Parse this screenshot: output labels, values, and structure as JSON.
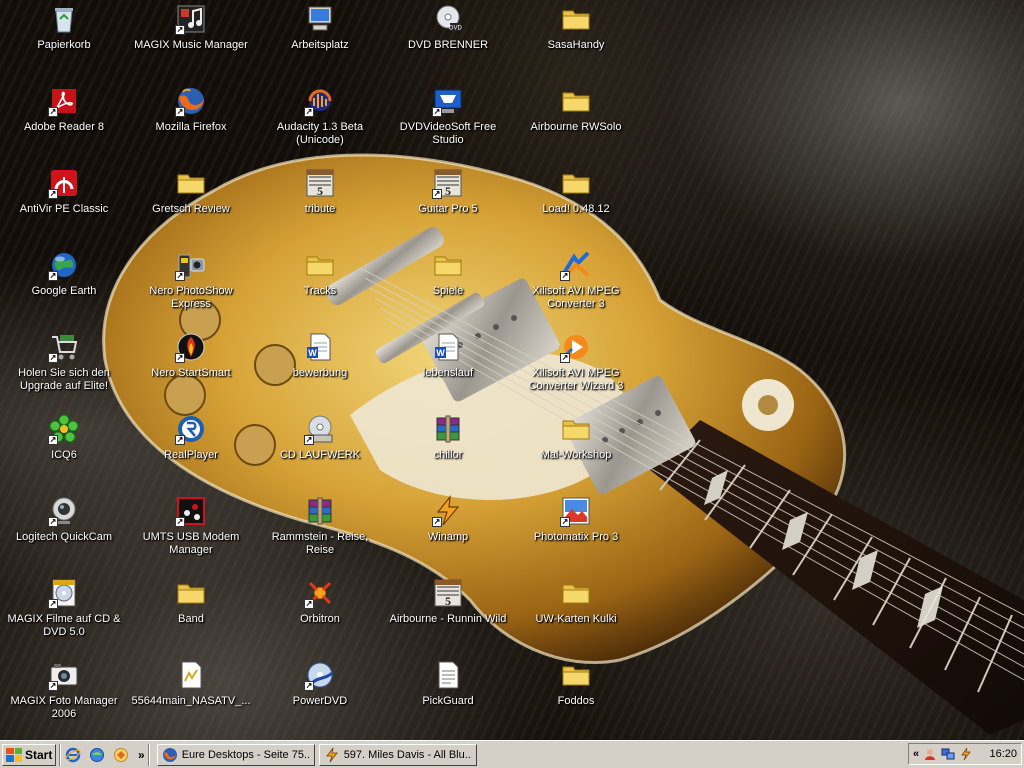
{
  "desktop": {
    "columns": [
      [
        {
          "label": "Papierkorb",
          "icon": "recycle-bin-icon",
          "shortcut": false
        },
        {
          "label": "Adobe Reader 8",
          "icon": "adobe-reader-icon",
          "shortcut": true
        },
        {
          "label": "AntiVir PE Classic",
          "icon": "antivir-umbrella-icon",
          "shortcut": true
        },
        {
          "label": "Google Earth",
          "icon": "google-earth-icon",
          "shortcut": true
        },
        {
          "label": "Holen Sie sich den Upgrade auf Elite!",
          "icon": "shopping-cart-icon",
          "shortcut": true
        },
        {
          "label": "ICQ6",
          "icon": "icq-flower-icon",
          "shortcut": true
        },
        {
          "label": "Logitech QuickCam",
          "icon": "webcam-icon",
          "shortcut": true
        },
        {
          "label": "MAGIX Filme auf CD & DVD 5.0",
          "icon": "magix-dvd-icon",
          "shortcut": true
        },
        {
          "label": "MAGIX Foto Manager 2006",
          "icon": "magix-camera-icon",
          "shortcut": true
        }
      ],
      [
        {
          "label": "MAGIX Music Manager",
          "icon": "magix-music-icon",
          "shortcut": true
        },
        {
          "label": "Mozilla Firefox",
          "icon": "firefox-icon",
          "shortcut": true
        },
        {
          "label": "Gretsch Review",
          "icon": "folder-icon",
          "shortcut": false
        },
        {
          "label": "Nero PhotoShow Express",
          "icon": "nero-photoshow-icon",
          "shortcut": true
        },
        {
          "label": "Nero StartSmart",
          "icon": "nero-startsmart-icon",
          "shortcut": true
        },
        {
          "label": "RealPlayer",
          "icon": "realplayer-icon",
          "shortcut": true
        },
        {
          "label": "UMTS USB Modem Manager",
          "icon": "umts-modem-icon",
          "shortcut": true
        },
        {
          "label": "Band",
          "icon": "folder-icon",
          "shortcut": false
        },
        {
          "label": "55644main_NASATV_...",
          "icon": "script-file-icon",
          "shortcut": false
        }
      ],
      [
        {
          "label": "Arbeitsplatz",
          "icon": "my-computer-icon",
          "shortcut": false
        },
        {
          "label": "Audacity 1.3 Beta (Unicode)",
          "icon": "audacity-icon",
          "shortcut": true
        },
        {
          "label": "tribute",
          "icon": "guitar-pro-file-icon",
          "shortcut": false
        },
        {
          "label": "Tracks",
          "icon": "folder-icon",
          "shortcut": false
        },
        {
          "label": "bewerbung",
          "icon": "word-document-icon",
          "shortcut": false
        },
        {
          "label": "CD LAUFWERK",
          "icon": "cd-drive-icon",
          "shortcut": true
        },
        {
          "label": "Rammstein - Reise, Reise",
          "icon": "winrar-archive-icon",
          "shortcut": false
        },
        {
          "label": "Orbitron",
          "icon": "orbitron-satellite-icon",
          "shortcut": true
        },
        {
          "label": "PowerDVD",
          "icon": "powerdvd-icon",
          "shortcut": true
        }
      ],
      [
        {
          "label": "DVD BRENNER",
          "icon": "dvd-drive-icon",
          "shortcut": false
        },
        {
          "label": "DVDVideoSoft Free Studio",
          "icon": "dvdvideosoft-icon",
          "shortcut": true
        },
        {
          "label": "Guitar Pro 5",
          "icon": "guitar-pro-icon",
          "shortcut": true
        },
        {
          "label": "Spiele",
          "icon": "folder-icon",
          "shortcut": false
        },
        {
          "label": "lebenslauf",
          "icon": "word-document-icon",
          "shortcut": false
        },
        {
          "label": "chillor",
          "icon": "winrar-archive-icon",
          "shortcut": false
        },
        {
          "label": "Winamp",
          "icon": "winamp-icon",
          "shortcut": true
        },
        {
          "label": "Airbourne - Runnin Wild",
          "icon": "guitar-pro-file-icon",
          "shortcut": false
        },
        {
          "label": "PickGuard",
          "icon": "text-document-icon",
          "shortcut": false
        }
      ],
      [
        {
          "label": "SasaHandy",
          "icon": "folder-icon",
          "shortcut": false
        },
        {
          "label": "Airbourne RWSolo",
          "icon": "folder-icon",
          "shortcut": false
        },
        {
          "label": "Load! 0.48.12",
          "icon": "folder-icon",
          "shortcut": false
        },
        {
          "label": "Xilisoft AVI MPEG Converter 3",
          "icon": "xilisoft-converter-icon",
          "shortcut": true
        },
        {
          "label": "Xilisoft AVI MPEG Converter Wizard 3",
          "icon": "xilisoft-wizard-icon",
          "shortcut": true
        },
        {
          "label": "Mal-Workshop",
          "icon": "folder-icon",
          "shortcut": false
        },
        {
          "label": "Photomatix Pro 3",
          "icon": "photomatix-icon",
          "shortcut": true
        },
        {
          "label": "UW-Karten Kulki",
          "icon": "folder-icon",
          "shortcut": false
        },
        {
          "label": "Foddos",
          "icon": "folder-icon",
          "shortcut": false
        }
      ]
    ]
  },
  "taskbar": {
    "start_label": "Start",
    "quick_launch": [
      {
        "name": "internet-explorer-icon"
      },
      {
        "name": "show-desktop-icon"
      },
      {
        "name": "browser-icon"
      }
    ],
    "more_label": "»",
    "tasks": [
      {
        "label": "Eure Desktops - Seite 75...",
        "icon": "firefox-icon"
      },
      {
        "label": "597. Miles Davis - All Blu...",
        "icon": "winamp-icon"
      }
    ],
    "tray": {
      "expand_label": "«",
      "icons": [
        "messenger-icon",
        "network-icon",
        "winamp-tray-icon"
      ],
      "time": "16:20"
    }
  },
  "colors": {
    "taskbar": "#d4d0c8",
    "folder": "#f2d35a",
    "label_text": "#ffffff"
  }
}
